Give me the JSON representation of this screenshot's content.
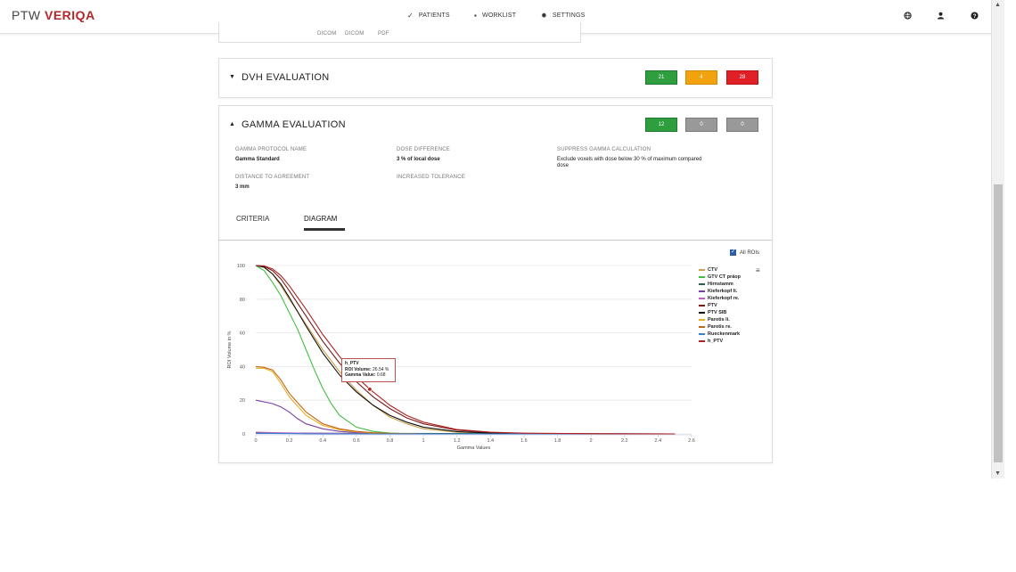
{
  "app": {
    "logo_ptw": "PTW",
    "logo_veriqa": "VERIQA"
  },
  "nav": {
    "patients": "PATIENTS",
    "worklist": "WORKLIST",
    "settings": "SETTINGS"
  },
  "prev_card": {
    "file_labels": [
      "DICOM",
      "DICOM",
      "PDF"
    ]
  },
  "dvh": {
    "title": "DVH EVALUATION",
    "counts": {
      "pass": "21",
      "warn": "4",
      "fail": "28"
    },
    "colors": {
      "pass": "#2e9e3e",
      "warn": "#f2a20c",
      "fail": "#e01f26"
    }
  },
  "gamma": {
    "title": "GAMMA EVALUATION",
    "counts": {
      "pass": "12",
      "warn": "0",
      "fail": "0"
    },
    "fields": {
      "protocol_label": "GAMMA PROTOCOL NAME",
      "protocol_value": "Gamma Standard",
      "dose_label": "DOSE DIFFERENCE",
      "dose_value": "3  %  of  local dose",
      "suppress_label": "SUPPRESS GAMMA CALCULATION",
      "suppress_value": "Exclude voxels with dose below 30 % of maximum compared dose",
      "dta_label": "DISTANCE TO AGREEMENT",
      "dta_value": "3 mm",
      "tol_label": "INCREASED TOLERANCE"
    },
    "tabs": [
      "CRITERIA",
      "DIAGRAM"
    ],
    "active_tab": "DIAGRAM"
  },
  "diagram": {
    "all_rois_label": "All ROIs",
    "all_rois_checked": true
  },
  "tooltip": {
    "series": "h_PTV",
    "roi_label": "ROI Volume:",
    "roi_value": "26.54 %",
    "gamma_label": "Gamma Value:",
    "gamma_value": "0.68"
  },
  "chart_data": {
    "type": "line",
    "xlabel": "Gamma Values",
    "ylabel": "ROI Volume in %",
    "xlim": [
      0,
      2.6
    ],
    "ylim": [
      0,
      100
    ],
    "x_ticks": [
      "0",
      "0.2",
      "0.4",
      "0.6",
      "0.8",
      "1",
      "1.2",
      "1.4",
      "1.6",
      "1.8",
      "2",
      "2.2",
      "2.4",
      "2.6"
    ],
    "y_ticks": [
      "0",
      "20",
      "40",
      "60",
      "80",
      "100"
    ],
    "grid": "horizontal",
    "legend_position": "right",
    "series": [
      {
        "name": "CTV",
        "color": "#c9a14a",
        "x": [
          0,
          0.05,
          0.1,
          0.15,
          0.2,
          0.3,
          0.4,
          0.5,
          0.6,
          0.7,
          0.8,
          0.9,
          1.0,
          1.2,
          1.5,
          2.0,
          2.5
        ],
        "y": [
          100,
          99,
          95,
          88,
          80,
          65,
          50,
          37,
          26,
          17,
          10,
          6,
          3,
          1,
          0.3,
          0,
          0
        ]
      },
      {
        "name": "GTV CT präop",
        "color": "#3fbf3f",
        "x": [
          0,
          0.05,
          0.1,
          0.15,
          0.2,
          0.25,
          0.3,
          0.35,
          0.4,
          0.45,
          0.5,
          0.6,
          0.7,
          0.8,
          0.9,
          1.0
        ],
        "y": [
          100,
          97,
          90,
          82,
          72,
          62,
          50,
          38,
          27,
          18,
          11,
          4,
          1.5,
          0.5,
          0.1,
          0
        ]
      },
      {
        "name": "Hirnstamm",
        "color": "#2e5e4e",
        "x": [
          0,
          2.5
        ],
        "y": [
          0.5,
          0
        ]
      },
      {
        "name": "Kieferkopf li.",
        "color": "#7a3fa5",
        "x": [
          0,
          0.1,
          0.15,
          0.2,
          0.25,
          0.3,
          0.4,
          0.5,
          0.6,
          0.8,
          1.0
        ],
        "y": [
          20,
          18,
          16,
          13,
          9,
          6,
          3,
          1.5,
          0.8,
          0.2,
          0
        ]
      },
      {
        "name": "Kieferkopf re.",
        "color": "#c05fc0",
        "x": [
          0,
          0.1,
          0.2,
          0.3,
          0.4,
          0.5,
          0.6,
          0.8,
          1.0
        ],
        "y": [
          1,
          0.8,
          0.6,
          0.4,
          0.3,
          0.2,
          0.1,
          0.05,
          0
        ]
      },
      {
        "name": "PTV",
        "color": "#7a1a1a",
        "x": [
          0,
          0.05,
          0.1,
          0.15,
          0.2,
          0.3,
          0.4,
          0.5,
          0.6,
          0.7,
          0.8,
          0.9,
          1.0,
          1.2,
          1.4,
          1.6,
          2.0,
          2.5
        ],
        "y": [
          100,
          99.5,
          97,
          92,
          85,
          70,
          55,
          42,
          31,
          22,
          15,
          9.5,
          6,
          2.2,
          0.8,
          0.3,
          0.05,
          0
        ]
      },
      {
        "name": "PTV SIB",
        "color": "#111111",
        "x": [
          0,
          0.05,
          0.1,
          0.15,
          0.2,
          0.3,
          0.4,
          0.5,
          0.6,
          0.7,
          0.8,
          0.9,
          1.0,
          1.2,
          1.4,
          1.6,
          2.0,
          2.5
        ],
        "y": [
          100,
          99,
          95,
          89,
          81,
          64,
          48,
          35,
          25,
          17,
          11,
          7,
          4,
          1.4,
          0.5,
          0.2,
          0.05,
          0
        ]
      },
      {
        "name": "Parotis li.",
        "color": "#e8b020",
        "x": [
          0,
          0.05,
          0.1,
          0.15,
          0.2,
          0.3,
          0.4,
          0.5,
          0.6,
          0.7,
          0.8,
          1.0
        ],
        "y": [
          39,
          39,
          37,
          30,
          22,
          11,
          5,
          2.5,
          1.2,
          0.6,
          0.3,
          0
        ]
      },
      {
        "name": "Parotis re.",
        "color": "#c06818",
        "x": [
          0,
          0.05,
          0.1,
          0.15,
          0.2,
          0.3,
          0.4,
          0.5,
          0.6,
          0.7,
          0.8,
          1.0
        ],
        "y": [
          40,
          39.5,
          38,
          32,
          24,
          13,
          6,
          3,
          1.5,
          0.7,
          0.3,
          0
        ]
      },
      {
        "name": "Rueckenmark",
        "color": "#3a7fd0",
        "x": [
          0,
          0.1,
          0.2,
          0.3,
          0.4,
          2.5
        ],
        "y": [
          0.3,
          0.3,
          0.2,
          0.1,
          0,
          0
        ]
      },
      {
        "name": "h_PTV",
        "color": "#b22222",
        "x": [
          0,
          0.05,
          0.1,
          0.15,
          0.2,
          0.3,
          0.4,
          0.5,
          0.6,
          0.68,
          0.8,
          0.9,
          1.0,
          1.2,
          1.4,
          1.6,
          2.0,
          2.5
        ],
        "y": [
          100,
          99.8,
          98,
          94,
          88,
          74,
          59,
          46,
          34,
          26.54,
          17,
          11,
          7,
          2.6,
          1,
          0.4,
          0.1,
          0
        ]
      }
    ],
    "highlight": {
      "series": "h_PTV",
      "x": 0.68,
      "y": 26.54
    }
  }
}
